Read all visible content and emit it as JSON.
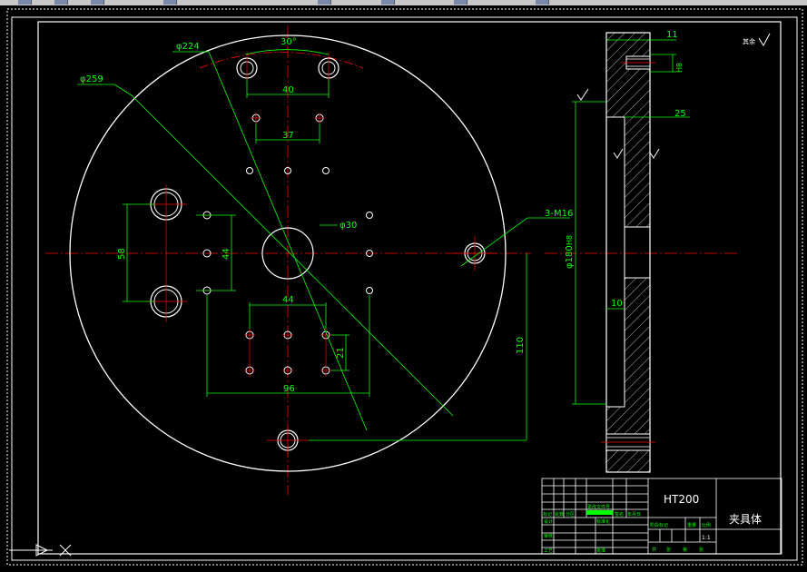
{
  "colors": {
    "background": "#000000",
    "outline": "#ffffff",
    "dimension": "#00ff00",
    "centerline": "#ff0000",
    "hatch": "#ffffff",
    "toolbar": "#c8c8c8"
  },
  "drawing": {
    "dims": {
      "phi224": "φ224",
      "phi259": "φ259",
      "angle30": "30°",
      "d40": "40",
      "d37": "37",
      "d58": "58",
      "d44v": "44",
      "phi30": "φ30",
      "m16": "3-M16",
      "d44h": "44",
      "d21": "21",
      "d96": "96",
      "d110": "110",
      "d11": "11",
      "d25": "25",
      "d10": "10",
      "phi180": "φ180",
      "phi180_suffix": "H8",
      "d25_suffix": "H8"
    },
    "roughness_general": "其余"
  },
  "title_block": {
    "material": "HT200",
    "part_name": "夹具体",
    "scale": "1:1",
    "labels": [
      "标记",
      "处数",
      "分区",
      "更改文件号",
      "签名",
      "年月日",
      "设计",
      "标准化",
      "阶段标记",
      "重量",
      "比例",
      "审核",
      "工艺",
      "批准",
      "共",
      "张",
      "第",
      "张"
    ]
  }
}
